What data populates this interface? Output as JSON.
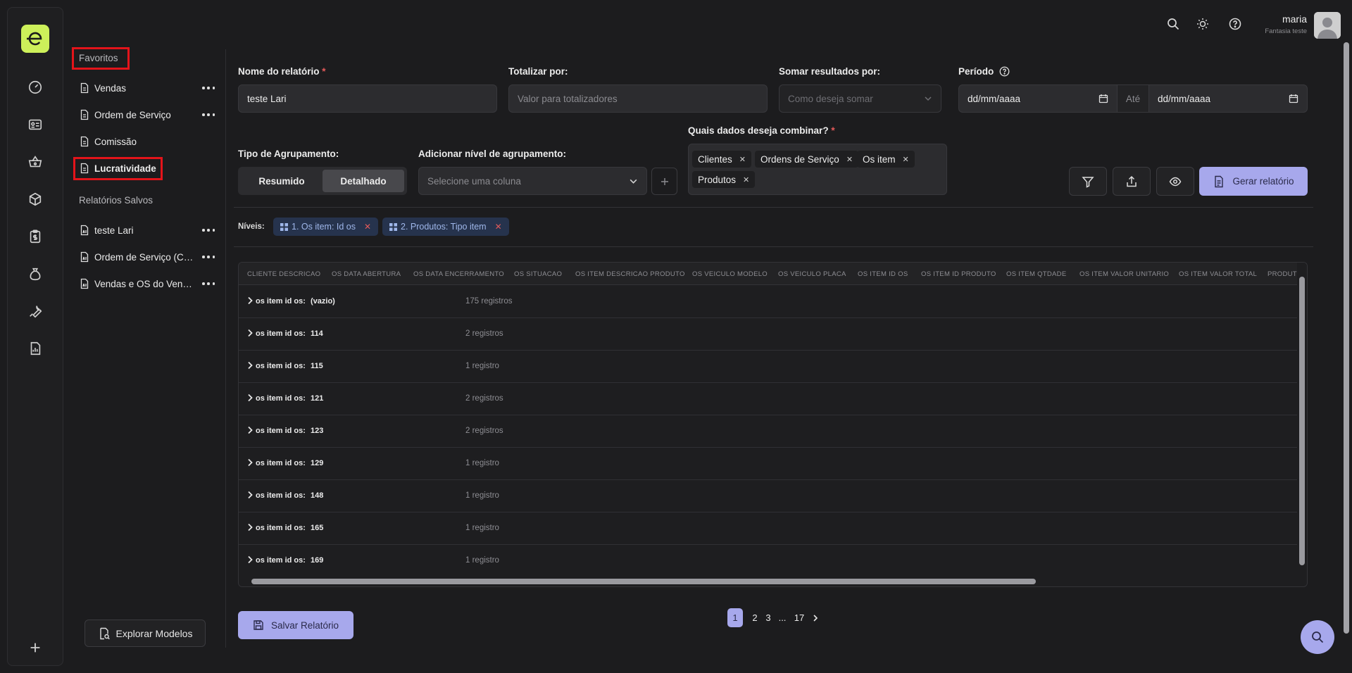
{
  "user": {
    "name": "maria",
    "company": "Fantasia teste"
  },
  "sidebar": {
    "favorites_label": "Favoritos",
    "favorites": [
      {
        "label": "Vendas",
        "has_menu": true
      },
      {
        "label": "Ordem de Serviço",
        "has_menu": true
      },
      {
        "label": "Comissão",
        "has_menu": false
      },
      {
        "label": "Lucratividade",
        "has_menu": false
      }
    ],
    "saved_label": "Relatórios Salvos",
    "saved": [
      {
        "label": "teste Lari"
      },
      {
        "label": "Ordem de Serviço (Cópia)"
      },
      {
        "label": "Vendas e OS do Vendedor"
      }
    ],
    "explore_label": "Explorar Modelos"
  },
  "form": {
    "report_name_label": "Nome do relatório",
    "report_name_value": "teste Lari",
    "total_by_label": "Totalizar por:",
    "total_by_placeholder": "Valor para totalizadores",
    "sum_by_label": "Somar resultados por:",
    "sum_by_placeholder": "Como deseja somar",
    "period_label": "Período",
    "date_from": "dd/mm/aaaa",
    "date_to_label": "Até",
    "date_to": "dd/mm/aaaa",
    "grouping_type_label": "Tipo de Agrupamento:",
    "grouping_options": [
      "Resumido",
      "Detalhado"
    ],
    "grouping_selected": "Detalhado",
    "add_level_label": "Adicionar nível de agrupamento:",
    "add_level_placeholder": "Selecione uma coluna",
    "combine_label": "Quais dados deseja combinar?",
    "combine_tags": [
      "Clientes",
      "Ordens de Serviço",
      "Os item",
      "Produtos"
    ],
    "generate_label": "Gerar relatório"
  },
  "levels": {
    "label": "Níveis:",
    "chips": [
      "1. Os item: Id os",
      "2. Produtos: Tipo item"
    ]
  },
  "table": {
    "columns": [
      "CLIENTE DESCRICAO",
      "OS DATA ABERTURA",
      "OS DATA ENCERRAMENTO",
      "OS SITUACAO",
      "OS ITEM DESCRICAO PRODUTO",
      "OS VEICULO MODELO",
      "OS VEICULO PLACA",
      "OS ITEM ID OS",
      "OS ITEM ID PRODUTO",
      "OS ITEM QTDADE",
      "OS ITEM VALOR UNITARIO",
      "OS ITEM VALOR TOTAL",
      "PRODUTO"
    ],
    "rows": [
      {
        "key": "os item id os:",
        "value": "(vazio)",
        "count": "175 registros"
      },
      {
        "key": "os item id os:",
        "value": "114",
        "count": "2 registros"
      },
      {
        "key": "os item id os:",
        "value": "115",
        "count": "1 registro"
      },
      {
        "key": "os item id os:",
        "value": "121",
        "count": "2 registros"
      },
      {
        "key": "os item id os:",
        "value": "123",
        "count": "2 registros"
      },
      {
        "key": "os item id os:",
        "value": "129",
        "count": "1 registro"
      },
      {
        "key": "os item id os:",
        "value": "148",
        "count": "1 registro"
      },
      {
        "key": "os item id os:",
        "value": "165",
        "count": "1 registro"
      },
      {
        "key": "os item id os:",
        "value": "169",
        "count": "1 registro"
      }
    ]
  },
  "footer": {
    "save_label": "Salvar Relatório",
    "pages": [
      "1",
      "2",
      "3",
      "...",
      "17"
    ],
    "current_page": "1"
  },
  "colors": {
    "accent": "#a7a8ec",
    "brand": "#cdf05a",
    "highlight_box": "#e3141a"
  }
}
